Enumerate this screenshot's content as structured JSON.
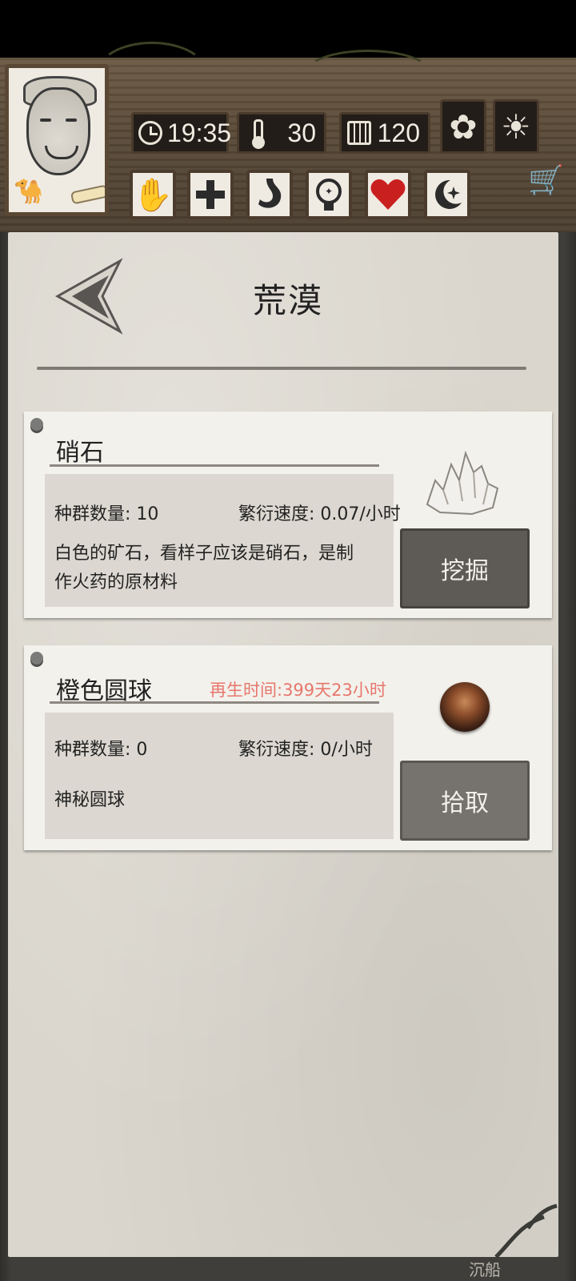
{
  "status_bar": {
    "time": "19:35",
    "temperature": "30",
    "days": "120"
  },
  "header": {
    "status_icons": [
      "hand-icon",
      "medical-cross-icon",
      "stomach-icon",
      "head-mind-icon",
      "heart-icon",
      "moon-star-icon"
    ],
    "weather_icons": [
      "sunflower-icon",
      "sun-icon"
    ]
  },
  "page": {
    "title": "荒漠"
  },
  "resources": [
    {
      "name": "硝石",
      "regen": "",
      "population_label": "种群数量: 10",
      "speed_label": "繁衍速度: 0.07/小时",
      "description_line1": "白色的矿石，看样子应该是硝石，是制",
      "description_line2": "作火药的原材料",
      "action": "挖掘",
      "image": "saltpeter-crystal"
    },
    {
      "name": "橙色圆球",
      "regen": "再生时间:399天23小时",
      "population_label": "种群数量: 0",
      "speed_label": "繁衍速度: 0/小时",
      "description_line1": "神秘圆球",
      "description_line2": "",
      "action": "拾取",
      "image": "orange-orb"
    }
  ],
  "footer": {
    "text": "沉船"
  },
  "colors": {
    "regen_text": "#e6776c",
    "button_dark": "#5e5a55",
    "button_light": "#76736e",
    "paper": "#dad6cd"
  }
}
